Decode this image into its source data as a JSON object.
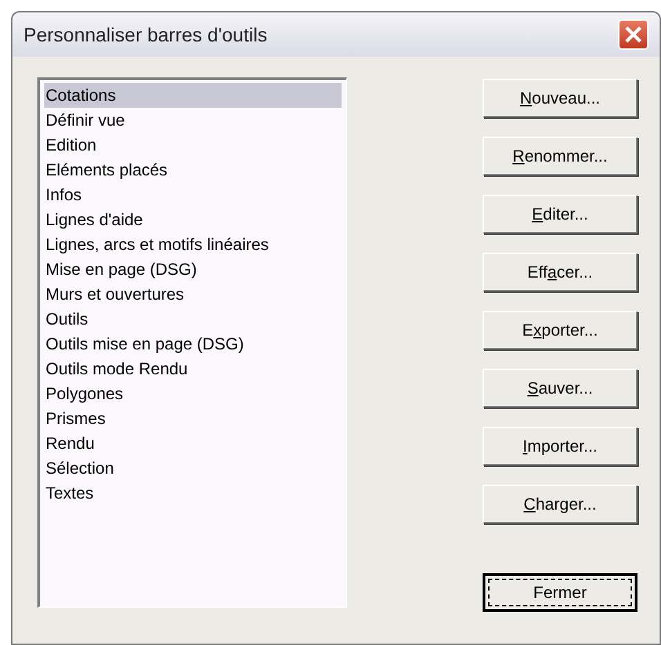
{
  "window": {
    "title": "Personnaliser barres d'outils"
  },
  "list": {
    "items": [
      {
        "label": "Cotations",
        "selected": true
      },
      {
        "label": "Définir vue",
        "selected": false
      },
      {
        "label": "Edition",
        "selected": false
      },
      {
        "label": "Eléments placés",
        "selected": false
      },
      {
        "label": "Infos",
        "selected": false
      },
      {
        "label": "Lignes d'aide",
        "selected": false
      },
      {
        "label": "Lignes, arcs et motifs linéaires",
        "selected": false
      },
      {
        "label": "Mise en page (DSG)",
        "selected": false
      },
      {
        "label": "Murs et ouvertures",
        "selected": false
      },
      {
        "label": "Outils",
        "selected": false
      },
      {
        "label": "Outils mise en page (DSG)",
        "selected": false
      },
      {
        "label": "Outils mode Rendu",
        "selected": false
      },
      {
        "label": "Polygones",
        "selected": false
      },
      {
        "label": "Prismes",
        "selected": false
      },
      {
        "label": "Rendu",
        "selected": false
      },
      {
        "label": "Sélection",
        "selected": false
      },
      {
        "label": "Textes",
        "selected": false
      }
    ]
  },
  "buttons": [
    {
      "key": "N",
      "after": "ouveau...",
      "default": false
    },
    {
      "key": "R",
      "after": "enommer...",
      "default": false
    },
    {
      "key": "E",
      "after": "diter...",
      "default": false
    },
    {
      "before": "Eff",
      "key": "a",
      "after": "cer...",
      "default": false
    },
    {
      "before": "E",
      "key": "x",
      "after": "porter...",
      "default": false
    },
    {
      "key": "S",
      "after": "auver...",
      "default": false
    },
    {
      "key": "I",
      "after": "mporter...",
      "default": false
    },
    {
      "key": "C",
      "after": "harger...",
      "default": false
    },
    {
      "before": "Fermer",
      "default": true
    }
  ]
}
